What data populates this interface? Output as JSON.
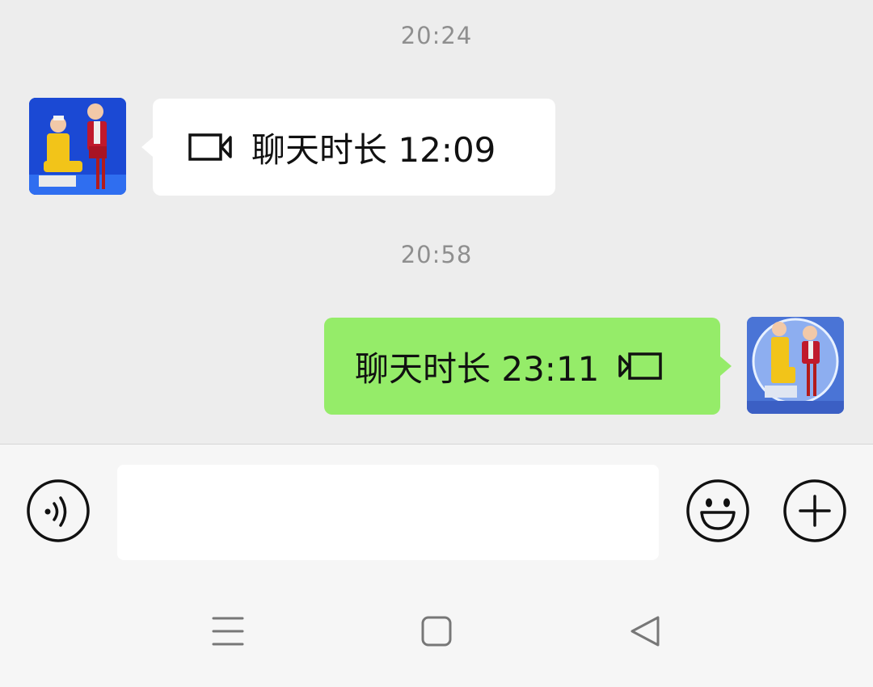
{
  "messages": [
    {
      "timestamp": "20:24",
      "direction": "received",
      "text": "聊天时长 12:09",
      "icon": "video-call-icon"
    },
    {
      "timestamp": "20:58",
      "direction": "sent",
      "text": "聊天时长 23:11",
      "icon": "video-call-icon"
    }
  ],
  "input_bar": {
    "voice_icon": "voice-icon",
    "text_value": "",
    "emoji_icon": "emoji-icon",
    "more_icon": "plus-icon"
  },
  "nav_bar": {
    "menu_icon": "menu-icon",
    "home_icon": "home-icon",
    "back_icon": "back-icon"
  },
  "colors": {
    "chat_background": "#ededed",
    "received_bubble": "#ffffff",
    "sent_bubble": "#95ec69",
    "timestamp_text": "#8f8f8f",
    "input_bar_background": "#f6f6f6"
  }
}
